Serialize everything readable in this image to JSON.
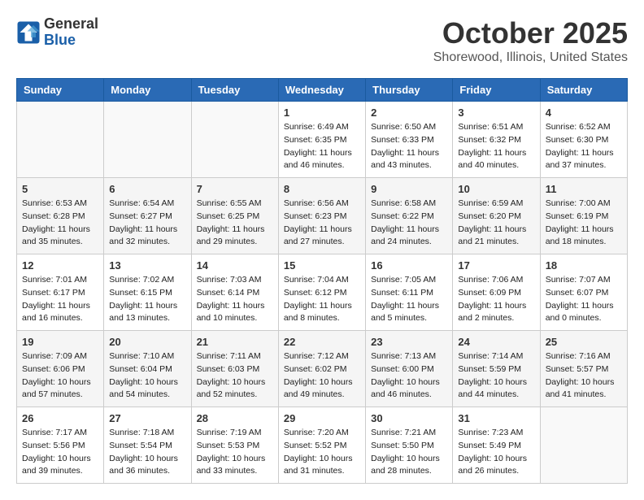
{
  "header": {
    "logo_general": "General",
    "logo_blue": "Blue",
    "month": "October 2025",
    "location": "Shorewood, Illinois, United States"
  },
  "weekdays": [
    "Sunday",
    "Monday",
    "Tuesday",
    "Wednesday",
    "Thursday",
    "Friday",
    "Saturday"
  ],
  "weeks": [
    [
      {
        "day": "",
        "info": ""
      },
      {
        "day": "",
        "info": ""
      },
      {
        "day": "",
        "info": ""
      },
      {
        "day": "1",
        "info": "Sunrise: 6:49 AM\nSunset: 6:35 PM\nDaylight: 11 hours\nand 46 minutes."
      },
      {
        "day": "2",
        "info": "Sunrise: 6:50 AM\nSunset: 6:33 PM\nDaylight: 11 hours\nand 43 minutes."
      },
      {
        "day": "3",
        "info": "Sunrise: 6:51 AM\nSunset: 6:32 PM\nDaylight: 11 hours\nand 40 minutes."
      },
      {
        "day": "4",
        "info": "Sunrise: 6:52 AM\nSunset: 6:30 PM\nDaylight: 11 hours\nand 37 minutes."
      }
    ],
    [
      {
        "day": "5",
        "info": "Sunrise: 6:53 AM\nSunset: 6:28 PM\nDaylight: 11 hours\nand 35 minutes."
      },
      {
        "day": "6",
        "info": "Sunrise: 6:54 AM\nSunset: 6:27 PM\nDaylight: 11 hours\nand 32 minutes."
      },
      {
        "day": "7",
        "info": "Sunrise: 6:55 AM\nSunset: 6:25 PM\nDaylight: 11 hours\nand 29 minutes."
      },
      {
        "day": "8",
        "info": "Sunrise: 6:56 AM\nSunset: 6:23 PM\nDaylight: 11 hours\nand 27 minutes."
      },
      {
        "day": "9",
        "info": "Sunrise: 6:58 AM\nSunset: 6:22 PM\nDaylight: 11 hours\nand 24 minutes."
      },
      {
        "day": "10",
        "info": "Sunrise: 6:59 AM\nSunset: 6:20 PM\nDaylight: 11 hours\nand 21 minutes."
      },
      {
        "day": "11",
        "info": "Sunrise: 7:00 AM\nSunset: 6:19 PM\nDaylight: 11 hours\nand 18 minutes."
      }
    ],
    [
      {
        "day": "12",
        "info": "Sunrise: 7:01 AM\nSunset: 6:17 PM\nDaylight: 11 hours\nand 16 minutes."
      },
      {
        "day": "13",
        "info": "Sunrise: 7:02 AM\nSunset: 6:15 PM\nDaylight: 11 hours\nand 13 minutes."
      },
      {
        "day": "14",
        "info": "Sunrise: 7:03 AM\nSunset: 6:14 PM\nDaylight: 11 hours\nand 10 minutes."
      },
      {
        "day": "15",
        "info": "Sunrise: 7:04 AM\nSunset: 6:12 PM\nDaylight: 11 hours\nand 8 minutes."
      },
      {
        "day": "16",
        "info": "Sunrise: 7:05 AM\nSunset: 6:11 PM\nDaylight: 11 hours\nand 5 minutes."
      },
      {
        "day": "17",
        "info": "Sunrise: 7:06 AM\nSunset: 6:09 PM\nDaylight: 11 hours\nand 2 minutes."
      },
      {
        "day": "18",
        "info": "Sunrise: 7:07 AM\nSunset: 6:07 PM\nDaylight: 11 hours\nand 0 minutes."
      }
    ],
    [
      {
        "day": "19",
        "info": "Sunrise: 7:09 AM\nSunset: 6:06 PM\nDaylight: 10 hours\nand 57 minutes."
      },
      {
        "day": "20",
        "info": "Sunrise: 7:10 AM\nSunset: 6:04 PM\nDaylight: 10 hours\nand 54 minutes."
      },
      {
        "day": "21",
        "info": "Sunrise: 7:11 AM\nSunset: 6:03 PM\nDaylight: 10 hours\nand 52 minutes."
      },
      {
        "day": "22",
        "info": "Sunrise: 7:12 AM\nSunset: 6:02 PM\nDaylight: 10 hours\nand 49 minutes."
      },
      {
        "day": "23",
        "info": "Sunrise: 7:13 AM\nSunset: 6:00 PM\nDaylight: 10 hours\nand 46 minutes."
      },
      {
        "day": "24",
        "info": "Sunrise: 7:14 AM\nSunset: 5:59 PM\nDaylight: 10 hours\nand 44 minutes."
      },
      {
        "day": "25",
        "info": "Sunrise: 7:16 AM\nSunset: 5:57 PM\nDaylight: 10 hours\nand 41 minutes."
      }
    ],
    [
      {
        "day": "26",
        "info": "Sunrise: 7:17 AM\nSunset: 5:56 PM\nDaylight: 10 hours\nand 39 minutes."
      },
      {
        "day": "27",
        "info": "Sunrise: 7:18 AM\nSunset: 5:54 PM\nDaylight: 10 hours\nand 36 minutes."
      },
      {
        "day": "28",
        "info": "Sunrise: 7:19 AM\nSunset: 5:53 PM\nDaylight: 10 hours\nand 33 minutes."
      },
      {
        "day": "29",
        "info": "Sunrise: 7:20 AM\nSunset: 5:52 PM\nDaylight: 10 hours\nand 31 minutes."
      },
      {
        "day": "30",
        "info": "Sunrise: 7:21 AM\nSunset: 5:50 PM\nDaylight: 10 hours\nand 28 minutes."
      },
      {
        "day": "31",
        "info": "Sunrise: 7:23 AM\nSunset: 5:49 PM\nDaylight: 10 hours\nand 26 minutes."
      },
      {
        "day": "",
        "info": ""
      }
    ]
  ]
}
